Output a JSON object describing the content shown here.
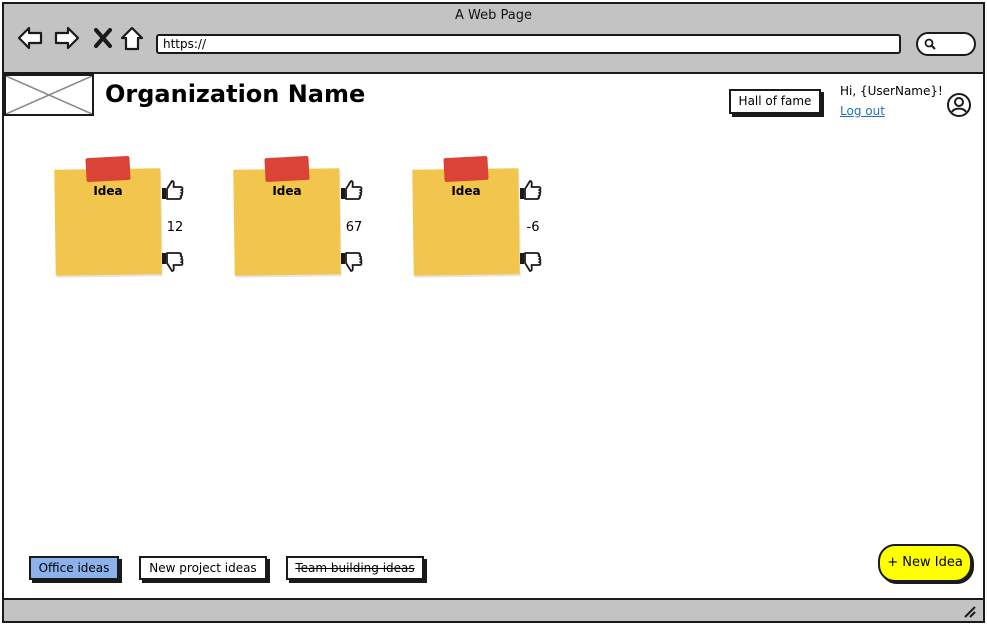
{
  "window": {
    "title": "A Web Page"
  },
  "nav": {
    "back_icon": "arrow-left-icon",
    "forward_icon": "arrow-right-icon",
    "close_icon": "x-icon",
    "home_icon": "home-icon"
  },
  "address_bar": {
    "value": "https://"
  },
  "search": {
    "icon": "search-icon"
  },
  "header": {
    "org_name": "Organization Name",
    "hall_of_fame_label": "Hall of fame",
    "greeting": "Hi, {UserName}!",
    "logout_label": "Log out",
    "user_icon": "user-circle-icon"
  },
  "ideas": [
    {
      "label": "Idea",
      "votes": "12"
    },
    {
      "label": "Idea",
      "votes": "67"
    },
    {
      "label": "Idea",
      "votes": "-6"
    }
  ],
  "tags": {
    "office": "Office ideas",
    "new_project": "New project ideas",
    "team_building": "Team building ideas"
  },
  "actions": {
    "new_idea_label": "+ New Idea"
  },
  "colors": {
    "chrome": "#c3c3c3",
    "sticky": "#f2c64c",
    "tape": "#dc4337",
    "active_tag": "#8cb2eb",
    "new_idea": "#ffff00",
    "link": "#1f6fd1"
  }
}
